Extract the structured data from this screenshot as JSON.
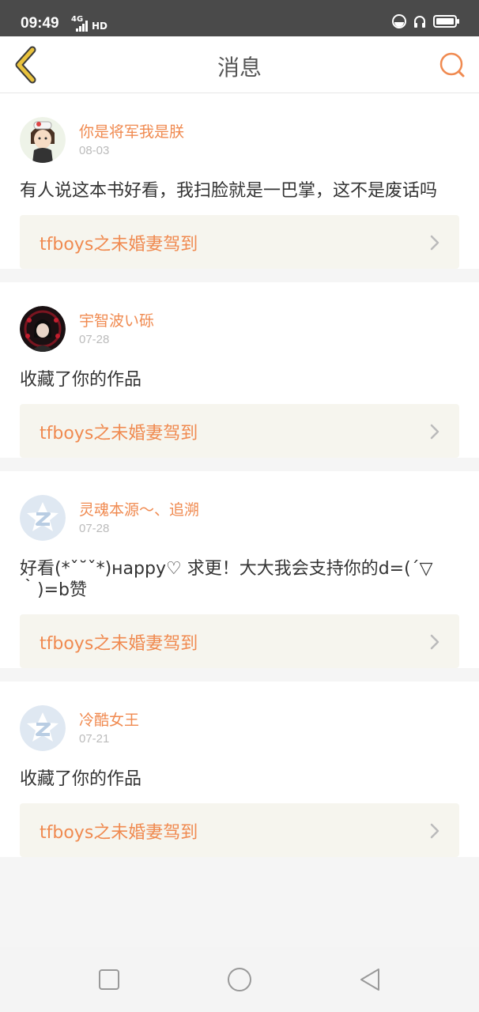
{
  "status": {
    "time": "09:49",
    "network": "4G",
    "hd": "HD"
  },
  "header": {
    "title": "消息"
  },
  "messages": [
    {
      "user": "你是将军我是朕",
      "date": "08-03",
      "text": "有人说这本书好看，我扫脸就是一巴掌，这不是废话吗",
      "book": "tfboys之未婚妻驾到"
    },
    {
      "user": "宇智波い砾",
      "date": "07-28",
      "text": "收藏了你的作品",
      "book": "tfboys之未婚妻驾到"
    },
    {
      "user": "灵魂本源〜、追溯",
      "date": "07-28",
      "text": "好看(*ˇ˘ˇ*)нappy♡ 求更！大大我会支持你的d=(´▽｀)=b赞",
      "book": "tfboys之未婚妻驾到"
    },
    {
      "user": "冷酷女王",
      "date": "07-21",
      "text": "收藏了你的作品",
      "book": "tfboys之未婚妻驾到"
    }
  ],
  "colors": {
    "accent": "#f08a50",
    "card_link_bg": "#f6f5ee",
    "status_bar": "#4a4a4a"
  },
  "icons": [
    "back-chevron-icon",
    "search-icon",
    "chevron-right-icon",
    "recent-apps-icon",
    "home-icon",
    "back-icon"
  ]
}
